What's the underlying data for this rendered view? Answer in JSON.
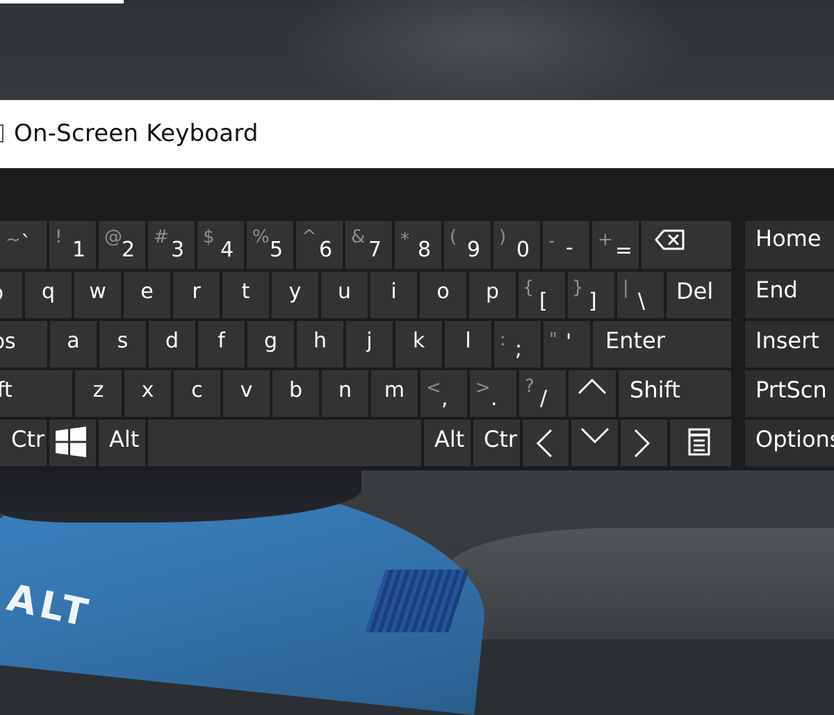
{
  "window": {
    "title": "On-Screen Keyboard"
  },
  "number_row": [
    {
      "shift": "~",
      "main": "`"
    },
    {
      "shift": "!",
      "main": "1"
    },
    {
      "shift": "@",
      "main": "2"
    },
    {
      "shift": "#",
      "main": "3"
    },
    {
      "shift": "$",
      "main": "4"
    },
    {
      "shift": "%",
      "main": "5"
    },
    {
      "shift": "^",
      "main": "6"
    },
    {
      "shift": "&",
      "main": "7"
    },
    {
      "shift": "*",
      "main": "8"
    },
    {
      "shift": "(",
      "main": "9"
    },
    {
      "shift": ")",
      "main": "0"
    },
    {
      "shift": "-",
      "main": "-"
    },
    {
      "shift": "+",
      "main": "="
    }
  ],
  "q_row": [
    "q",
    "w",
    "e",
    "r",
    "t",
    "y",
    "u",
    "i",
    "o",
    "p"
  ],
  "q_row_brackets": [
    {
      "shift": "{",
      "main": "["
    },
    {
      "shift": "}",
      "main": "]"
    },
    {
      "shift": "|",
      "main": "\\"
    }
  ],
  "a_row": [
    "a",
    "s",
    "d",
    "f",
    "g",
    "h",
    "j",
    "k",
    "l"
  ],
  "a_row_punct": [
    {
      "shift": ":",
      "main": ";"
    },
    {
      "shift": "\"",
      "main": "'"
    }
  ],
  "z_row": [
    "z",
    "x",
    "c",
    "v",
    "b",
    "n",
    "m"
  ],
  "z_row_punct": [
    {
      "shift": "<",
      "main": ","
    },
    {
      "shift": ">",
      "main": "."
    },
    {
      "shift": "?",
      "main": "/"
    }
  ],
  "labels": {
    "tab": "p",
    "caps": "ps",
    "shift_left": "ft",
    "ctrl_left": "Ctr",
    "alt_left": "Alt",
    "alt_right": "Alt",
    "ctrl_right": "Ctr",
    "del": "Del",
    "enter": "Enter",
    "shift_right": "Shift",
    "home": "Home",
    "end": "End",
    "insert": "Insert",
    "prtscn": "PrtScn",
    "options": "Options"
  },
  "icons": {
    "backspace": "backspace-icon",
    "windows": "windows-logo-icon",
    "up": "arrow-up-icon",
    "left": "arrow-left-icon",
    "down": "arrow-down-icon",
    "right": "arrow-right-icon",
    "menu": "context-menu-icon"
  },
  "wallpaper": {
    "car_text": "ALT"
  },
  "colors": {
    "key_bg": "#333333",
    "kb_bg": "#1c1c1c",
    "shift_char": "#8f8f8f",
    "title_bar": "#ffffff"
  }
}
